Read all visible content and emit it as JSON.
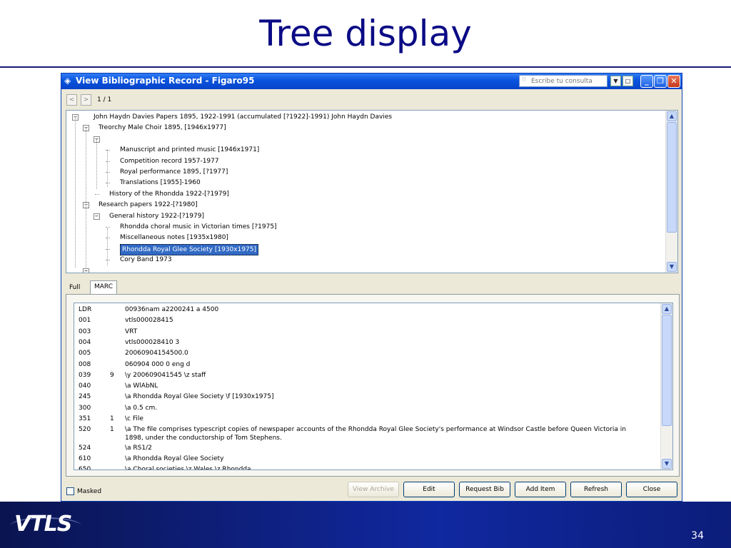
{
  "slide": {
    "title": "Tree display",
    "number": "34",
    "logo_text": "VTLS"
  },
  "window": {
    "title": "View Bibliographic Record - Figaro95",
    "search_placeholder": "Escribe tu consulta",
    "minimize_glyph": "_",
    "restore_glyph": "❐",
    "close_glyph": "✕"
  },
  "pager": {
    "prev_glyph": "<",
    "next_glyph": ">",
    "count": "1 / 1"
  },
  "tree": {
    "items": [
      {
        "label": "John Haydn Davies Papers 1895, 1922-1991 (accumulated [?1922]-1991) John Haydn Davies",
        "level": 0,
        "toggle": "⊟"
      },
      {
        "label": "Treorchy Male Choir 1895, [1946x1977]",
        "level": 1,
        "toggle": "⊟"
      },
      {
        "label": "",
        "level": 2,
        "toggle": "⊟"
      },
      {
        "label": "Manuscript and printed music [1946x1971]",
        "level": 3,
        "toggle": ""
      },
      {
        "label": "Competition record 1957-1977",
        "level": 3,
        "toggle": ""
      },
      {
        "label": "Royal performance 1895, [?1977]",
        "level": 3,
        "toggle": ""
      },
      {
        "label": "Translations [1955]-1960",
        "level": 3,
        "toggle": ""
      },
      {
        "label": "History of the Rhondda 1922-[?1979]",
        "level": 2,
        "toggle": ""
      },
      {
        "label": "Research papers 1922-[?1980]",
        "level": 1,
        "toggle": "⊟"
      },
      {
        "label": "General history 1922-[?1979]",
        "level": 2,
        "toggle": "⊟"
      },
      {
        "label": "Rhondda choral music in Victorian times [?1975]",
        "level": 3,
        "toggle": ""
      },
      {
        "label": "Miscellaneous notes [1935x1980]",
        "level": 3,
        "toggle": ""
      },
      {
        "label": "Rhondda Royal Glee Society [1930x1975]",
        "level": 3,
        "toggle": "",
        "selected": true
      },
      {
        "label": "Cory Band 1973",
        "level": 3,
        "toggle": ""
      },
      {
        "label": "",
        "level": 1,
        "toggle": "⊟"
      }
    ]
  },
  "tabs": [
    {
      "label": "Full"
    },
    {
      "label": "MARC",
      "active": true
    }
  ],
  "marc": {
    "rows": [
      {
        "tag": "LDR",
        "ind": "",
        "value": "00936nam a2200241 a 4500"
      },
      {
        "tag": "001",
        "ind": "",
        "value": "vtls000028415"
      },
      {
        "tag": "003",
        "ind": "",
        "value": "VRT"
      },
      {
        "tag": "004",
        "ind": "",
        "value": "vtls000028410 3"
      },
      {
        "tag": "005",
        "ind": "",
        "value": "20060904154500.0"
      },
      {
        "tag": "008",
        "ind": "",
        "value": "060904                    000 0 eng d"
      },
      {
        "tag": "039",
        "ind": "9",
        "value": "\\y 200609041545 \\z staff"
      },
      {
        "tag": "040",
        "ind": "",
        "value": "\\a WlAbNL"
      },
      {
        "tag": "245",
        "ind": "",
        "value": "\\a Rhondda Royal Glee Society \\f [1930x1975]"
      },
      {
        "tag": "300",
        "ind": "",
        "value": "\\a 0.5 cm."
      },
      {
        "tag": "351",
        "ind": "1",
        "value": "\\c File"
      },
      {
        "tag": "520",
        "ind": "1",
        "value": "\\a The file comprises typescript copies of newspaper accounts of the Rhondda Royal Glee Society's performance at Windsor Castle before Queen Victoria in 1898, under the conductorship of Tom Stephens."
      },
      {
        "tag": "524",
        "ind": "",
        "value": "\\a RS1/2"
      },
      {
        "tag": "610",
        "ind": "",
        "value": "\\a Rhondda Royal Glee Society"
      },
      {
        "tag": "650",
        "ind": "",
        "value": "\\a Choral societies \\z Wales \\z Rhondda"
      }
    ]
  },
  "footer": {
    "masked_label": "Masked",
    "buttons": {
      "view_archive": "View Archive",
      "edit": "Edit",
      "request_bib": "Request Bib",
      "add_item": "Add Item",
      "refresh": "Refresh",
      "close": "Close"
    }
  },
  "scroll": {
    "up_glyph": "▲",
    "down_glyph": "▼"
  }
}
